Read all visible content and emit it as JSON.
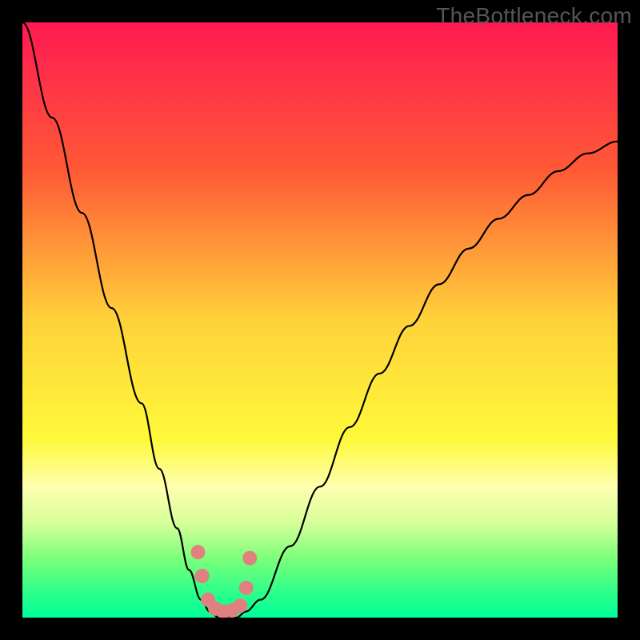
{
  "watermark": "TheBottleneck.com",
  "chart_data": {
    "type": "line",
    "title": "",
    "xlabel": "",
    "ylabel": "",
    "xlim": [
      0,
      100
    ],
    "ylim": [
      0,
      100
    ],
    "background_gradient": {
      "stops": [
        {
          "offset": 0,
          "color": "#ff1a52"
        },
        {
          "offset": 25,
          "color": "#ff5a36"
        },
        {
          "offset": 50,
          "color": "#ffd23a"
        },
        {
          "offset": 70,
          "color": "#fff93a"
        },
        {
          "offset": 78,
          "color": "#feffb0"
        },
        {
          "offset": 84,
          "color": "#d8ff9a"
        },
        {
          "offset": 90,
          "color": "#7dff7a"
        },
        {
          "offset": 96,
          "color": "#2aff8a"
        },
        {
          "offset": 100,
          "color": "#00ff99"
        }
      ]
    },
    "series": [
      {
        "name": "bottleneck-curve",
        "color": "#000000",
        "x": [
          0,
          5,
          10,
          15,
          20,
          23,
          26,
          28,
          30,
          31.5,
          33,
          34.5,
          36,
          37.5,
          40,
          45,
          50,
          55,
          60,
          65,
          70,
          75,
          80,
          85,
          90,
          95,
          100
        ],
        "y": [
          100,
          84,
          68,
          52,
          36,
          25,
          15,
          8,
          3,
          1,
          0,
          0,
          0,
          1,
          3,
          12,
          22,
          32,
          41,
          49,
          56,
          62,
          67,
          71,
          75,
          78,
          80
        ]
      }
    ],
    "markers": {
      "name": "highlight-points",
      "color": "#e08080",
      "x": [
        29.5,
        30.2,
        31.2,
        32.4,
        33.8,
        35.2,
        36.6,
        37.6,
        38.2
      ],
      "y": [
        11,
        7,
        3,
        1.5,
        1,
        1.2,
        2,
        5,
        10
      ]
    }
  }
}
